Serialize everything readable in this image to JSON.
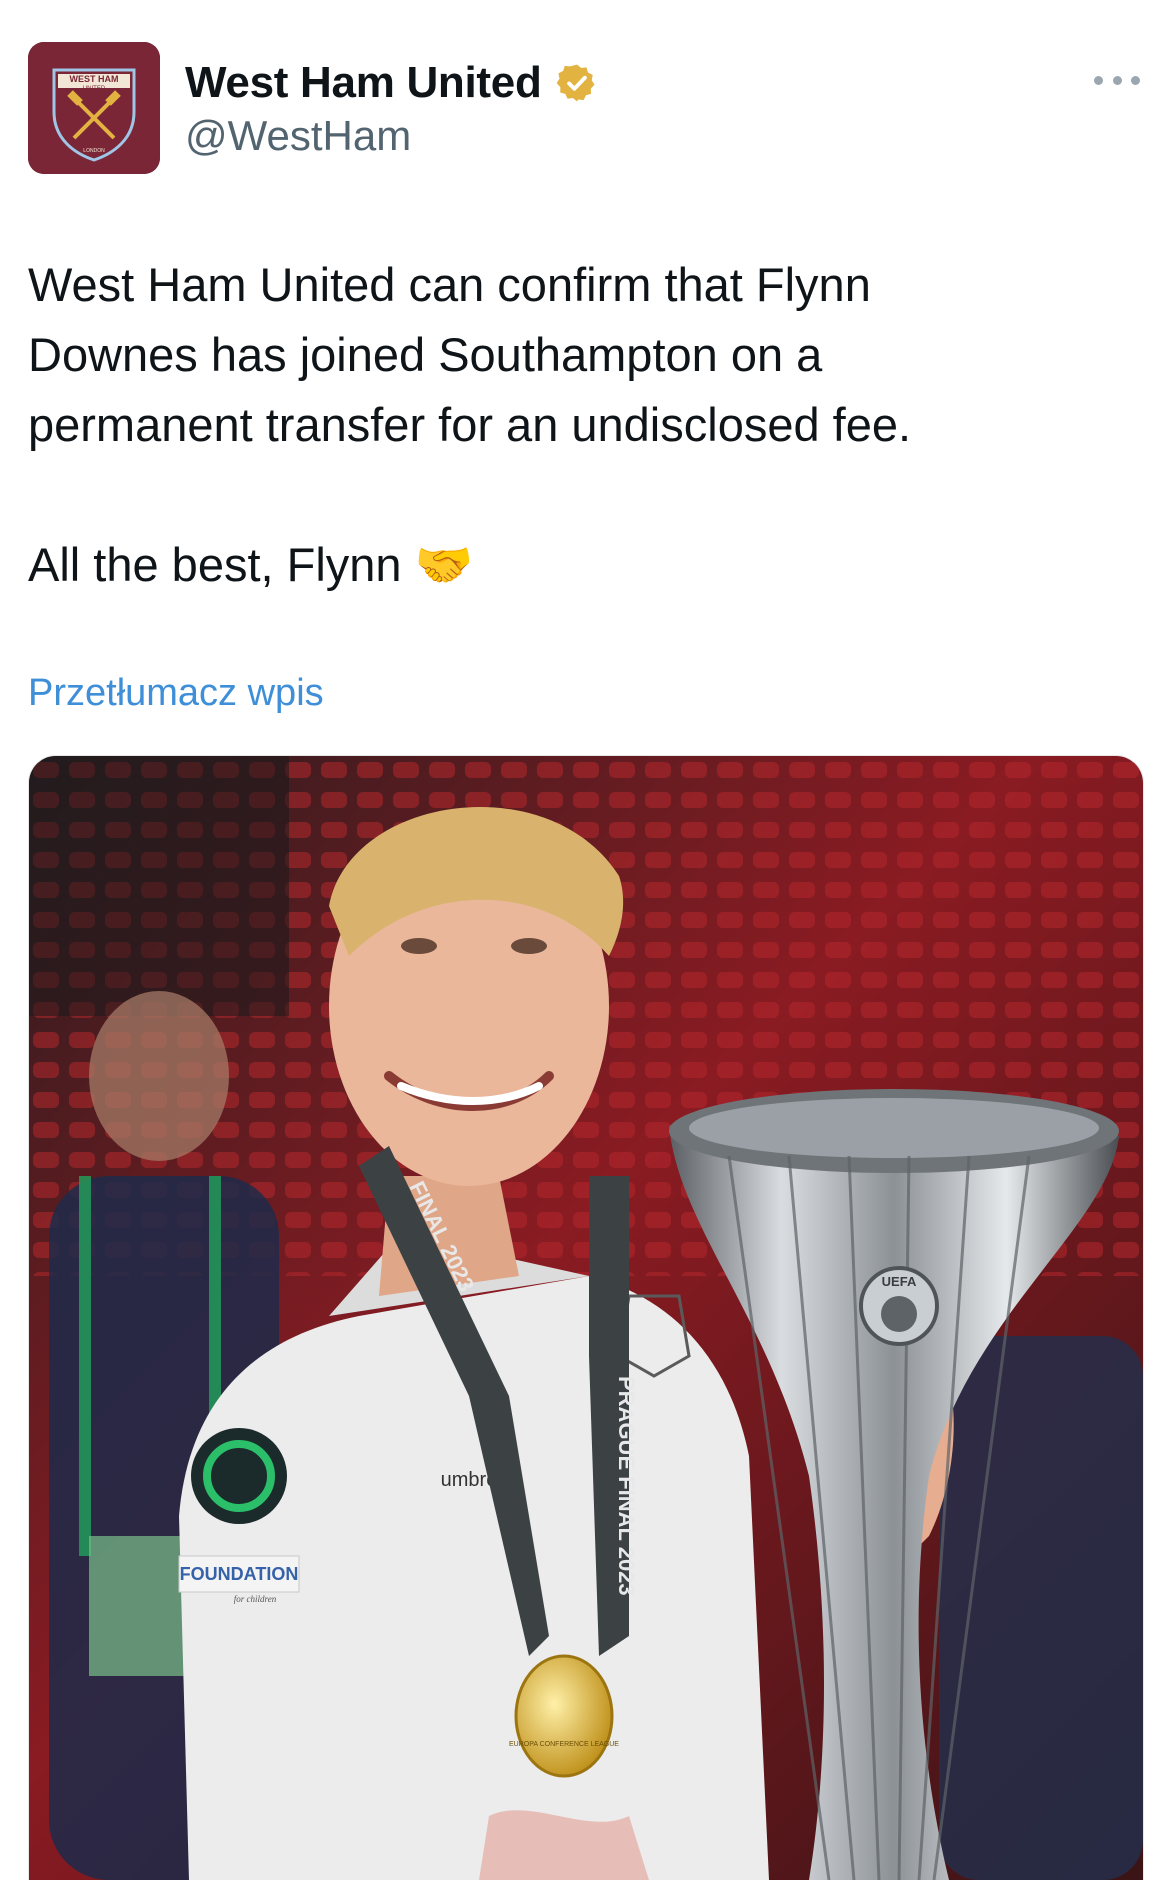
{
  "account": {
    "display_name": "West Ham United",
    "handle": "@WestHam",
    "verified_icon": "verified-badge-gold"
  },
  "crest": {
    "top_text": "WEST HAM",
    "sub_text": "UNITED",
    "bottom_text": "LONDON"
  },
  "tweet": {
    "text": "West Ham United can confirm that Flynn\nDownes has joined Southampton on a\npermanent transfer for an undisclosed fee.\n\nAll the best, Flynn 🤝",
    "translate_label": "Przetłumacz wpis"
  },
  "photo": {
    "lanyard_text": "PRAGUE FINAL 2023",
    "lanyard_text_short": "FINAL 2023",
    "sleeve_patch": "FOUNDATION",
    "sleeve_patch_sub": "for children",
    "kit_brand": "umbro",
    "trophy_badge": "UEFA",
    "medal_text": "EUROPA CONFERENCE LEAGUE"
  },
  "colors": {
    "crest_bg": "#7a2637",
    "verified": "#e3b341",
    "link": "#3f8fd8",
    "muted": "#536471"
  }
}
